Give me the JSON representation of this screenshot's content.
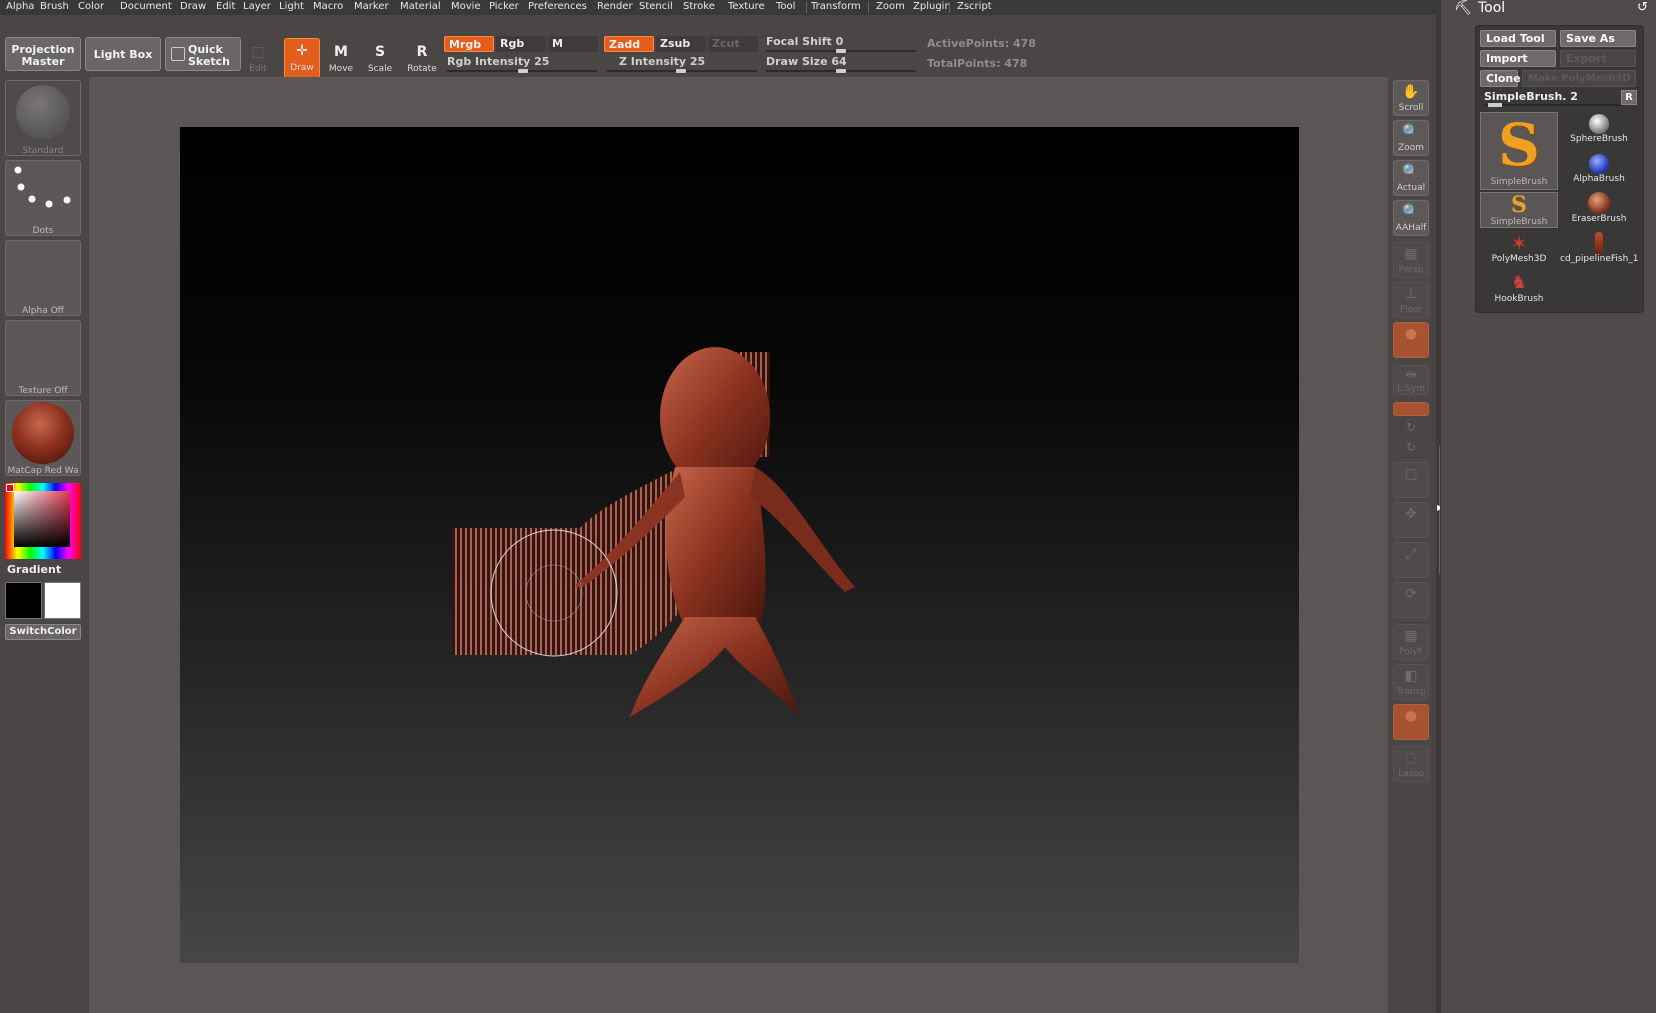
{
  "menu": [
    "Alpha",
    "Brush",
    "Color",
    "Document",
    "Draw",
    "Edit",
    "Layer",
    "Light",
    "Macro",
    "Marker",
    "Material",
    "Movie",
    "Picker",
    "Preferences",
    "Render",
    "Stencil",
    "Stroke",
    "Texture",
    "Tool",
    "Transform",
    "Zoom",
    "Zplugin",
    "Zscript"
  ],
  "toolbar": {
    "projection_master": "Projection Master",
    "light_box": "Light Box",
    "quick_sketch": "Quick Sketch",
    "edit": "Edit",
    "draw": "Draw",
    "move": "Move",
    "scale": "Scale",
    "rotate": "Rotate",
    "mrgb": "Mrgb",
    "rgb": "Rgb",
    "m": "M",
    "zadd": "Zadd",
    "zsub": "Zsub",
    "zcut": "Zcut",
    "rgb_intensity": "Rgb Intensity 25",
    "z_intensity": "Z Intensity 25",
    "focal_shift": "Focal Shift 0",
    "draw_size": "Draw Size 64",
    "active_points": "ActivePoints: 478",
    "total_points": "TotalPoints: 478"
  },
  "left_shelf": {
    "brush": "Standard",
    "stroke": "Dots",
    "alpha": "Alpha Off",
    "texture": "Texture Off",
    "material": "MatCap Red Wa",
    "gradient": "Gradient",
    "switch_color": "SwitchColor"
  },
  "right_shelf": [
    "Scroll",
    "Zoom",
    "Actual",
    "AAHalf",
    "Persp",
    "Floor",
    "",
    "L.Sym",
    "",
    "",
    "",
    "",
    "",
    "",
    "",
    "",
    "PolyF",
    "Transp",
    "",
    "Lasso"
  ],
  "tool_panel": {
    "title": "Tool",
    "load_tool": "Load Tool",
    "save_as": "Save As",
    "import": "Import",
    "export": "Export",
    "clone": "Clone",
    "make_polymesh": "Make PolyMesh3D",
    "current_tool": "SimpleBrush. 2",
    "r": "R",
    "items": [
      "SimpleBrush",
      "SphereBrush",
      "AlphaBrush",
      "SimpleBrush",
      "EraserBrush",
      "PolyMesh3D",
      "cd_pipelineFish_1",
      "HookBrush"
    ]
  }
}
